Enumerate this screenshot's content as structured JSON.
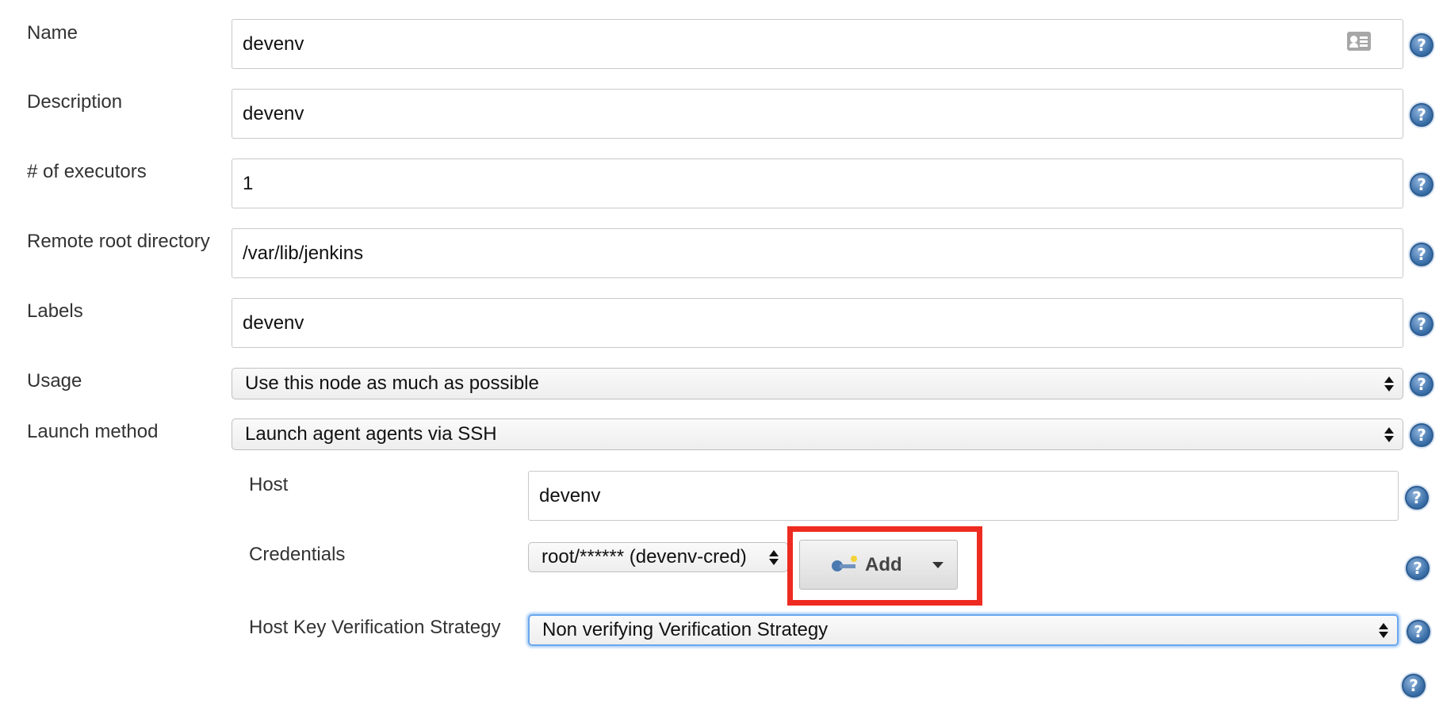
{
  "fields": {
    "name": {
      "label": "Name",
      "value": "devenv"
    },
    "description": {
      "label": "Description",
      "value": "devenv"
    },
    "executors": {
      "label": "# of executors",
      "value": "1"
    },
    "remote_root": {
      "label": "Remote root directory",
      "value": "/var/lib/jenkins"
    },
    "labels": {
      "label": "Labels",
      "value": "devenv"
    },
    "usage": {
      "label": "Usage",
      "value": "Use this node as much as possible"
    },
    "launch_method": {
      "label": "Launch method",
      "value": "Launch agent agents via SSH"
    }
  },
  "ssh": {
    "host": {
      "label": "Host",
      "value": "devenv"
    },
    "credentials": {
      "label": "Credentials",
      "value": "root/****** (devenv-cred)"
    },
    "add_button": {
      "label": "Add"
    },
    "host_key": {
      "label": "Host Key Verification Strategy",
      "value": "Non verifying Verification Strategy"
    }
  },
  "help_glyph": "?",
  "colors": {
    "highlight": "#ee2b20",
    "focus": "#6aa7ee",
    "help": "#3a6fa8"
  },
  "icons": [
    "contact-card-icon",
    "key-icon",
    "chevron-down-icon",
    "help-icon",
    "select-arrows-icon"
  ]
}
